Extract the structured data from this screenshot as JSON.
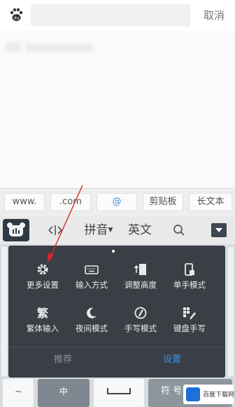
{
  "search": {
    "cancel_label": "取消"
  },
  "quick_inserts": [
    "www.",
    ".com",
    "@",
    "剪贴板",
    "长文本"
  ],
  "toolbar": {
    "pinyin_label": "拼音",
    "english_label": "英文"
  },
  "menu": {
    "items": [
      {
        "label": "更多设置",
        "icon": "gear-icon"
      },
      {
        "label": "输入方式",
        "icon": "keyboard-icon"
      },
      {
        "label": "调整高度",
        "icon": "height-adjust-icon"
      },
      {
        "label": "单手模式",
        "icon": "one-hand-icon"
      },
      {
        "label": "繁体输入",
        "icon": "traditional-chinese-icon"
      },
      {
        "label": "夜间模式",
        "icon": "moon-icon"
      },
      {
        "label": "手写模式",
        "icon": "handwriting-icon"
      },
      {
        "label": "键盘手写",
        "icon": "keyboard-handwriting-icon"
      }
    ],
    "tabs": {
      "recommend": "推荐",
      "settings": "设置"
    }
  },
  "bottom_keys": {
    "tilde": "~",
    "zh": "中",
    "symbol": "符 号"
  },
  "watermark": {
    "text": "百度下载网"
  },
  "colors": {
    "popup_bg": "#3a3f45",
    "accent": "#3d8ee6",
    "arrow": "#d9262a"
  }
}
